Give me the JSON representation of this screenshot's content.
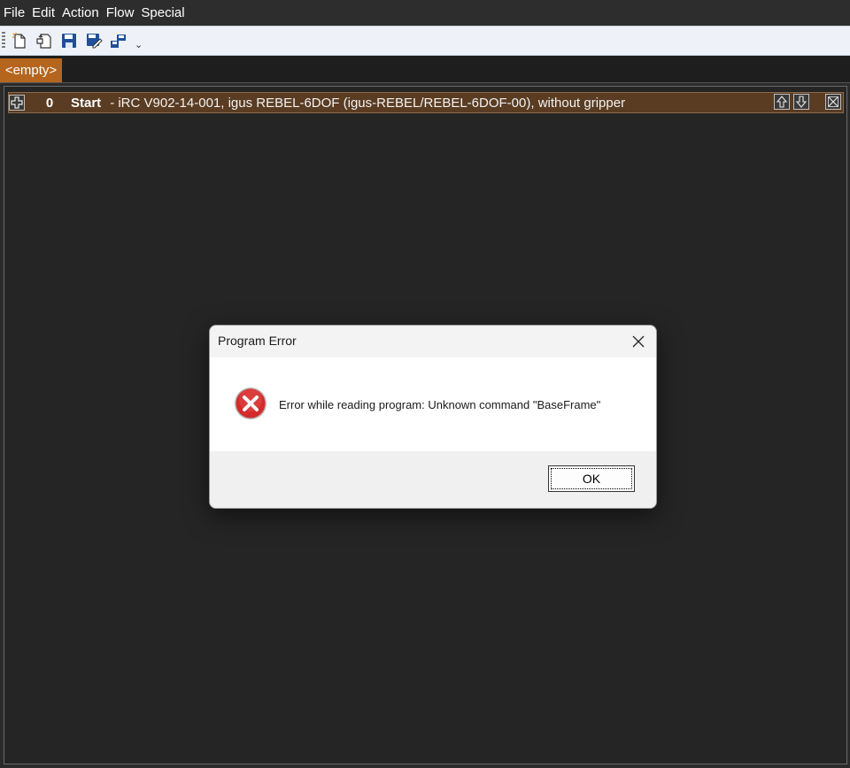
{
  "menu": {
    "items": [
      "File",
      "Edit",
      "Action",
      "Flow",
      "Special"
    ]
  },
  "toolbar": {
    "buttons": [
      "new-icon",
      "open-icon",
      "save-icon",
      "save-as-icon",
      "upload-icon"
    ],
    "overflow": "⌄"
  },
  "tabs": [
    {
      "label": "<empty>"
    }
  ],
  "program": {
    "row": {
      "index": "0",
      "label": "Start",
      "description": "- iRC V902-14-001, igus REBEL-6DOF (igus-REBEL/REBEL-6DOF-00), without gripper"
    }
  },
  "dialog": {
    "title": "Program Error",
    "message": "Error while reading program: Unknown command \"BaseFrame\"",
    "ok_label": "OK"
  },
  "colors": {
    "accent_tab": "#b5651d",
    "row_background": "#5a3c22",
    "error_red": "#d42b2b"
  }
}
